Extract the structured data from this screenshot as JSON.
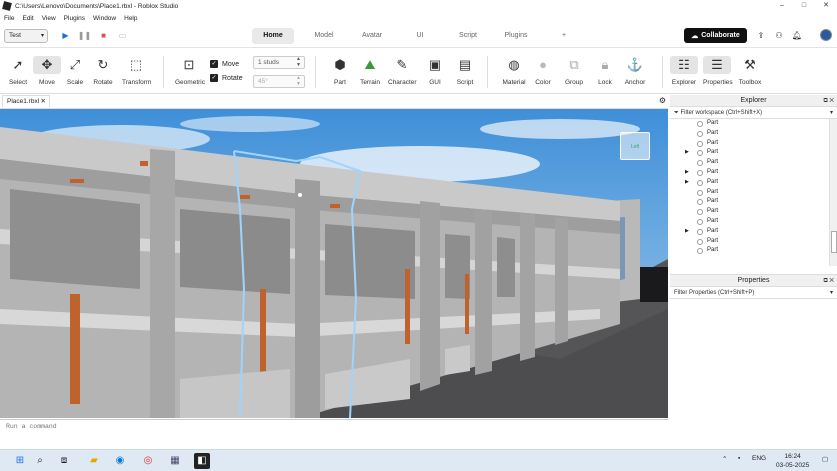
{
  "window": {
    "title": "C:\\Users\\Lenovo\\Documents\\Place1.rbxl - Roblox Studio",
    "minimize": "–",
    "maximize": "□",
    "close": "✕"
  },
  "menu": [
    "File",
    "Edit",
    "View",
    "Plugins",
    "Window",
    "Help"
  ],
  "mode_select": {
    "value": "Test"
  },
  "tabs": [
    "Home",
    "Model",
    "Avatar",
    "UI",
    "Script",
    "Plugins",
    "+"
  ],
  "collaborate": "Collaborate",
  "ribbon": {
    "select": "Select",
    "move": "Move",
    "scale": "Scale",
    "rotate": "Rotate",
    "transform": "Transform",
    "geometric": "Geometric",
    "move_toggle": "Move",
    "rotate_toggle": "Rotate",
    "move_snap": "1 studs",
    "rotate_snap": "45°",
    "part": "Part",
    "terrain": "Terrain",
    "character": "Character",
    "gui": "GUI",
    "script": "Script",
    "material": "Material",
    "color": "Color",
    "group": "Group",
    "lock": "Lock",
    "anchor": "Anchor",
    "explorer": "Explorer",
    "properties": "Properties",
    "toolbox": "Toolbox"
  },
  "document_tab": "Place1.rbxl",
  "explorer": {
    "title": "Explorer",
    "filter_placeholder": "Filter workspace (Ctrl+Shift+X)",
    "items": [
      {
        "label": "Part",
        "expandable": false
      },
      {
        "label": "Part",
        "expandable": false
      },
      {
        "label": "Part",
        "expandable": false
      },
      {
        "label": "Part",
        "expandable": true
      },
      {
        "label": "Part",
        "expandable": false
      },
      {
        "label": "Part",
        "expandable": true
      },
      {
        "label": "Part",
        "expandable": true
      },
      {
        "label": "Part",
        "expandable": false
      },
      {
        "label": "Part",
        "expandable": false
      },
      {
        "label": "Part",
        "expandable": false
      },
      {
        "label": "Part",
        "expandable": false
      },
      {
        "label": "Part",
        "expandable": true
      },
      {
        "label": "Part",
        "expandable": false
      },
      {
        "label": "Part",
        "expandable": false
      }
    ]
  },
  "properties": {
    "title": "Properties",
    "filter_placeholder": "Filter Properties (Ctrl+Shift+P)"
  },
  "command_bar": {
    "placeholder": "Run a command"
  },
  "viewcube": {
    "label": "Left"
  },
  "taskbar": {
    "language": "ENG",
    "time": "16:24",
    "date": "03-05-2025"
  }
}
